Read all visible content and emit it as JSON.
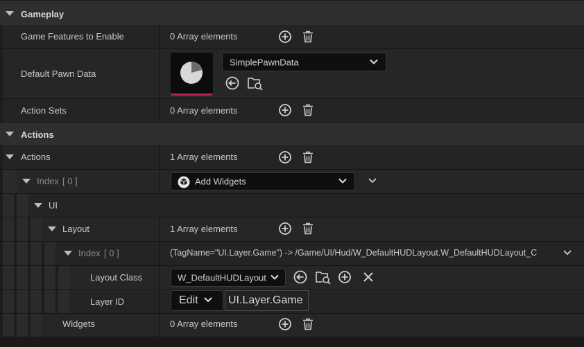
{
  "sections": {
    "gameplay": "Gameplay",
    "actions": "Actions"
  },
  "rows": {
    "game_features": {
      "label": "Game Features to Enable",
      "value": "0 Array elements"
    },
    "default_pawn": {
      "label": "Default Pawn Data",
      "asset": "SimplePawnData"
    },
    "action_sets": {
      "label": "Action Sets",
      "value": "0 Array elements"
    },
    "actions": {
      "label": "Actions",
      "value": "1 Array elements"
    },
    "index0": {
      "label": "Index",
      "bracket": "[ 0 ]",
      "action": "Add Widgets"
    },
    "ui": {
      "label": "UI"
    },
    "layout": {
      "label": "Layout",
      "value": "1 Array elements"
    },
    "layout_index": {
      "label": "Index",
      "bracket": "[ 0 ]",
      "value": "(TagName=\"UI.Layer.Game\") -> /Game/UI/Hud/W_DefaultHUDLayout.W_DefaultHUDLayout_C"
    },
    "layout_class": {
      "label": "Layout Class",
      "value": "W_DefaultHUDLayout"
    },
    "layer_id": {
      "label": "Layer ID",
      "edit": "Edit",
      "value": "UI.Layer.Game"
    },
    "widgets": {
      "label": "Widgets",
      "value": "0 Array elements"
    }
  },
  "icons": [
    "add-icon",
    "trash-icon",
    "browse-back-icon",
    "find-in-browser-icon",
    "x-icon",
    "chevron-down-icon"
  ]
}
